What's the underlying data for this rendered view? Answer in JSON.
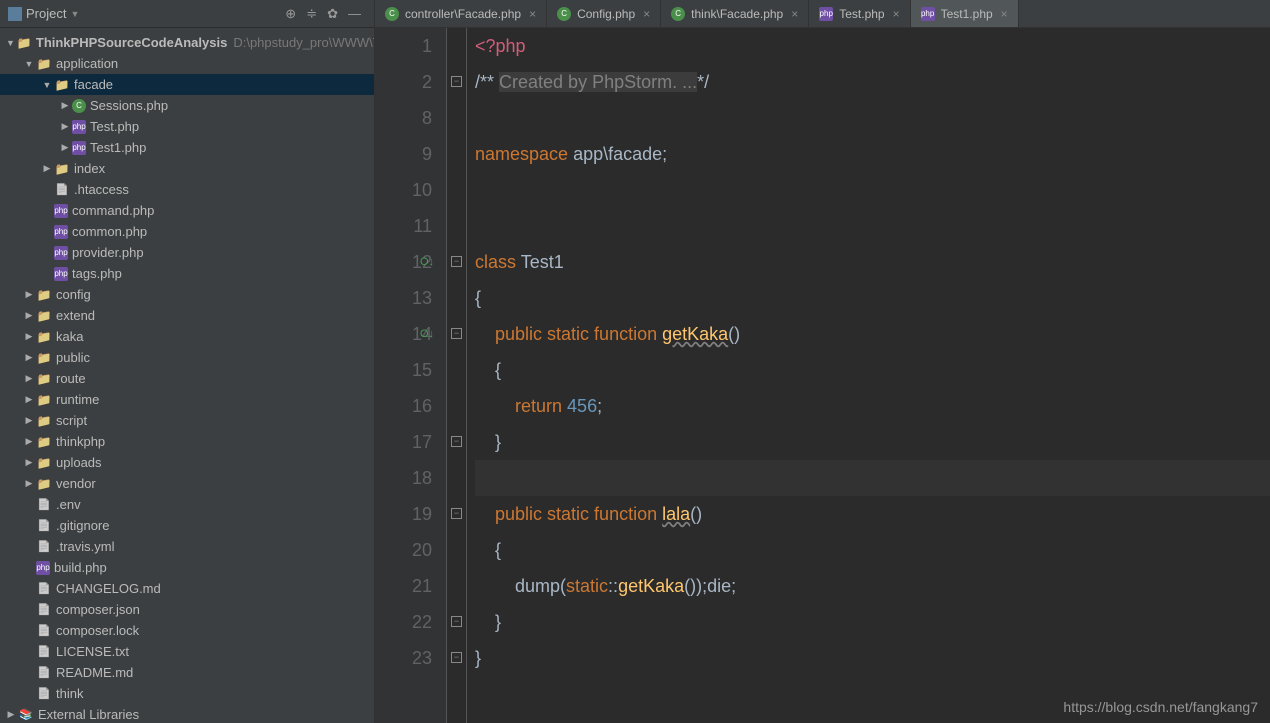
{
  "sidebar": {
    "title": "Project",
    "root": {
      "name": "ThinkPHPSourceCodeAnalysis",
      "path": "D:\\phpstudy_pro\\WWW\\Tk"
    },
    "tree": [
      {
        "label": "application",
        "indent": 1,
        "arrow": "▼",
        "type": "folder"
      },
      {
        "label": "facade",
        "indent": 2,
        "arrow": "▼",
        "type": "folder",
        "selected": true
      },
      {
        "label": "Sessions.php",
        "indent": 3,
        "arrow": "▶",
        "type": "php-c"
      },
      {
        "label": "Test.php",
        "indent": 3,
        "arrow": "▶",
        "type": "php"
      },
      {
        "label": "Test1.php",
        "indent": 3,
        "arrow": "▶",
        "type": "php"
      },
      {
        "label": "index",
        "indent": 2,
        "arrow": "▶",
        "type": "folder"
      },
      {
        "label": ".htaccess",
        "indent": 2,
        "arrow": "",
        "type": "file"
      },
      {
        "label": "command.php",
        "indent": 2,
        "arrow": "",
        "type": "php"
      },
      {
        "label": "common.php",
        "indent": 2,
        "arrow": "",
        "type": "php"
      },
      {
        "label": "provider.php",
        "indent": 2,
        "arrow": "",
        "type": "php"
      },
      {
        "label": "tags.php",
        "indent": 2,
        "arrow": "",
        "type": "php"
      },
      {
        "label": "config",
        "indent": 1,
        "arrow": "▶",
        "type": "folder"
      },
      {
        "label": "extend",
        "indent": 1,
        "arrow": "▶",
        "type": "folder"
      },
      {
        "label": "kaka",
        "indent": 1,
        "arrow": "▶",
        "type": "folder"
      },
      {
        "label": "public",
        "indent": 1,
        "arrow": "▶",
        "type": "folder"
      },
      {
        "label": "route",
        "indent": 1,
        "arrow": "▶",
        "type": "folder"
      },
      {
        "label": "runtime",
        "indent": 1,
        "arrow": "▶",
        "type": "folder"
      },
      {
        "label": "script",
        "indent": 1,
        "arrow": "▶",
        "type": "folder"
      },
      {
        "label": "thinkphp",
        "indent": 1,
        "arrow": "▶",
        "type": "folder"
      },
      {
        "label": "uploads",
        "indent": 1,
        "arrow": "▶",
        "type": "folder"
      },
      {
        "label": "vendor",
        "indent": 1,
        "arrow": "▶",
        "type": "folder"
      },
      {
        "label": ".env",
        "indent": 1,
        "arrow": "",
        "type": "file"
      },
      {
        "label": ".gitignore",
        "indent": 1,
        "arrow": "",
        "type": "file"
      },
      {
        "label": ".travis.yml",
        "indent": 1,
        "arrow": "",
        "type": "file"
      },
      {
        "label": "build.php",
        "indent": 1,
        "arrow": "",
        "type": "php"
      },
      {
        "label": "CHANGELOG.md",
        "indent": 1,
        "arrow": "",
        "type": "file"
      },
      {
        "label": "composer.json",
        "indent": 1,
        "arrow": "",
        "type": "file"
      },
      {
        "label": "composer.lock",
        "indent": 1,
        "arrow": "",
        "type": "file"
      },
      {
        "label": "LICENSE.txt",
        "indent": 1,
        "arrow": "",
        "type": "file"
      },
      {
        "label": "README.md",
        "indent": 1,
        "arrow": "",
        "type": "file"
      },
      {
        "label": "think",
        "indent": 1,
        "arrow": "",
        "type": "file"
      }
    ],
    "external": "External Libraries"
  },
  "tabs": [
    {
      "label": "controller\\Facade.php",
      "type": "php-c",
      "active": false
    },
    {
      "label": "Config.php",
      "type": "php-c",
      "active": false
    },
    {
      "label": "think\\Facade.php",
      "type": "php-c",
      "active": false
    },
    {
      "label": "Test.php",
      "type": "php",
      "active": false
    },
    {
      "label": "Test1.php",
      "type": "php",
      "active": true
    }
  ],
  "code": {
    "line_numbers": [
      "1",
      "2",
      "8",
      "9",
      "10",
      "11",
      "12",
      "13",
      "14",
      "15",
      "16",
      "17",
      "18",
      "19",
      "20",
      "21",
      "22",
      "23"
    ],
    "gutter_marks": {
      "12": "O↓",
      "14": "O↓"
    },
    "lines": {
      "1": {
        "tokens": [
          {
            "t": "<?php",
            "c": "phptag"
          }
        ]
      },
      "2": {
        "tokens": [
          {
            "t": "/** ",
            "c": "dflt"
          },
          {
            "t": "Created by PhpStorm. ...",
            "c": "cmt"
          },
          {
            "t": "*/",
            "c": "dflt"
          }
        ]
      },
      "8": {
        "tokens": []
      },
      "9": {
        "tokens": [
          {
            "t": "namespace ",
            "c": "kw"
          },
          {
            "t": "app\\facade;",
            "c": "ns"
          }
        ]
      },
      "10": {
        "tokens": []
      },
      "11": {
        "tokens": []
      },
      "12": {
        "tokens": [
          {
            "t": "class ",
            "c": "kw"
          },
          {
            "t": "Test1",
            "c": "dflt"
          }
        ]
      },
      "13": {
        "tokens": [
          {
            "t": "{",
            "c": "dflt"
          }
        ]
      },
      "14": {
        "tokens": [
          {
            "t": "    ",
            "c": "dflt"
          },
          {
            "t": "public static function ",
            "c": "kw"
          },
          {
            "t": "getKaka",
            "c": "fn u"
          },
          {
            "t": "()",
            "c": "dflt"
          }
        ]
      },
      "15": {
        "tokens": [
          {
            "t": "    {",
            "c": "dflt"
          }
        ]
      },
      "16": {
        "tokens": [
          {
            "t": "        ",
            "c": "dflt"
          },
          {
            "t": "return ",
            "c": "kw"
          },
          {
            "t": "456",
            "c": "num"
          },
          {
            "t": ";",
            "c": "dflt"
          }
        ]
      },
      "17": {
        "tokens": [
          {
            "t": "    }",
            "c": "dflt"
          }
        ]
      },
      "18": {
        "tokens": [],
        "hl": true
      },
      "19": {
        "tokens": [
          {
            "t": "    ",
            "c": "dflt"
          },
          {
            "t": "public static function ",
            "c": "kw"
          },
          {
            "t": "lala",
            "c": "fn u"
          },
          {
            "t": "()",
            "c": "dflt"
          }
        ]
      },
      "20": {
        "tokens": [
          {
            "t": "    {",
            "c": "dflt"
          }
        ]
      },
      "21": {
        "tokens": [
          {
            "t": "        dump(",
            "c": "dflt"
          },
          {
            "t": "static",
            "c": "kw"
          },
          {
            "t": "::",
            "c": "dflt"
          },
          {
            "t": "getKaka",
            "c": "fn"
          },
          {
            "t": "());",
            "c": "dflt"
          },
          {
            "t": "die",
            "c": "die"
          },
          {
            "t": ";",
            "c": "dflt"
          }
        ]
      },
      "22": {
        "tokens": [
          {
            "t": "    }",
            "c": "dflt"
          }
        ]
      },
      "23": {
        "tokens": [
          {
            "t": "}",
            "c": "dflt"
          }
        ]
      }
    }
  },
  "watermark": "https://blog.csdn.net/fangkang7"
}
